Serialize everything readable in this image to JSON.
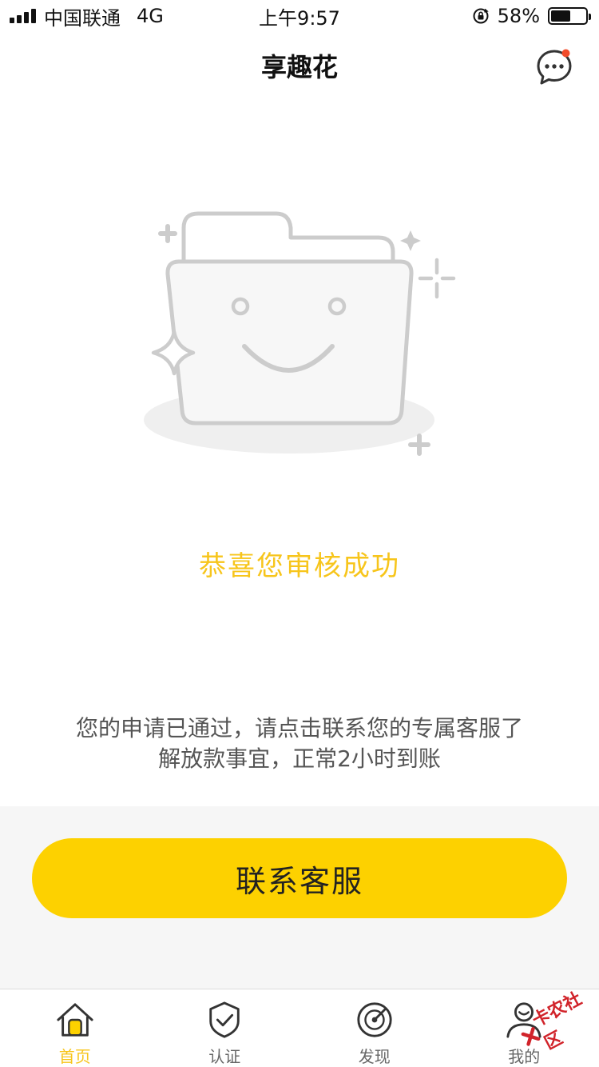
{
  "status_bar": {
    "carrier": "中国联通",
    "network": "4G",
    "time": "上午9:57",
    "battery_percent": "58%",
    "battery_level": 0.58
  },
  "nav": {
    "title": "享趣花",
    "message_icon": "chat-bubble-icon",
    "has_unread": true
  },
  "illustration": {
    "icon": "smiling-folder-icon"
  },
  "main": {
    "success_text": "恭喜您审核成功",
    "description_line1": "您的申请已通过，请点击联系您的专属客服了",
    "description_line2": "解放款事宜，正常2小时到账",
    "button_label": "联系客服"
  },
  "tabs": [
    {
      "label": "首页",
      "icon": "home-icon",
      "active": true
    },
    {
      "label": "认证",
      "icon": "shield-check-icon",
      "active": false
    },
    {
      "label": "发现",
      "icon": "radar-icon",
      "active": false
    },
    {
      "label": "我的",
      "icon": "user-icon",
      "active": false
    }
  ],
  "watermark": {
    "text": "卡农社区"
  },
  "colors": {
    "accent": "#fdd100",
    "success_text": "#f7c51b",
    "unread_dot": "#f24b2a",
    "page_gray": "#f6f6f6"
  }
}
